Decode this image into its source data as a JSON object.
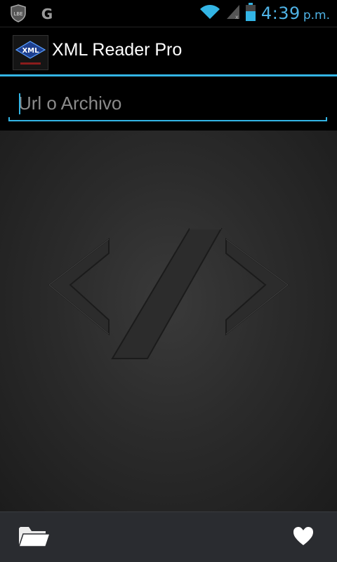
{
  "status_bar": {
    "time": "4:39",
    "ampm": "p.m.",
    "icons": [
      "shield-icon",
      "g-logo-icon",
      "wifi-icon",
      "signal-icon",
      "battery-icon"
    ],
    "shield_label": "LBE",
    "g_label": "G"
  },
  "action_bar": {
    "title": "XML Reader Pro",
    "logo_label": "XML"
  },
  "url_input": {
    "placeholder": "Url o Archivo",
    "value": ""
  },
  "bottom_bar": {
    "icons": [
      "folder-icon",
      "heart-icon"
    ]
  },
  "colors": {
    "accent": "#33b5e5",
    "time": "#4fb3e6",
    "bottom_bar": "#2a2c30"
  }
}
